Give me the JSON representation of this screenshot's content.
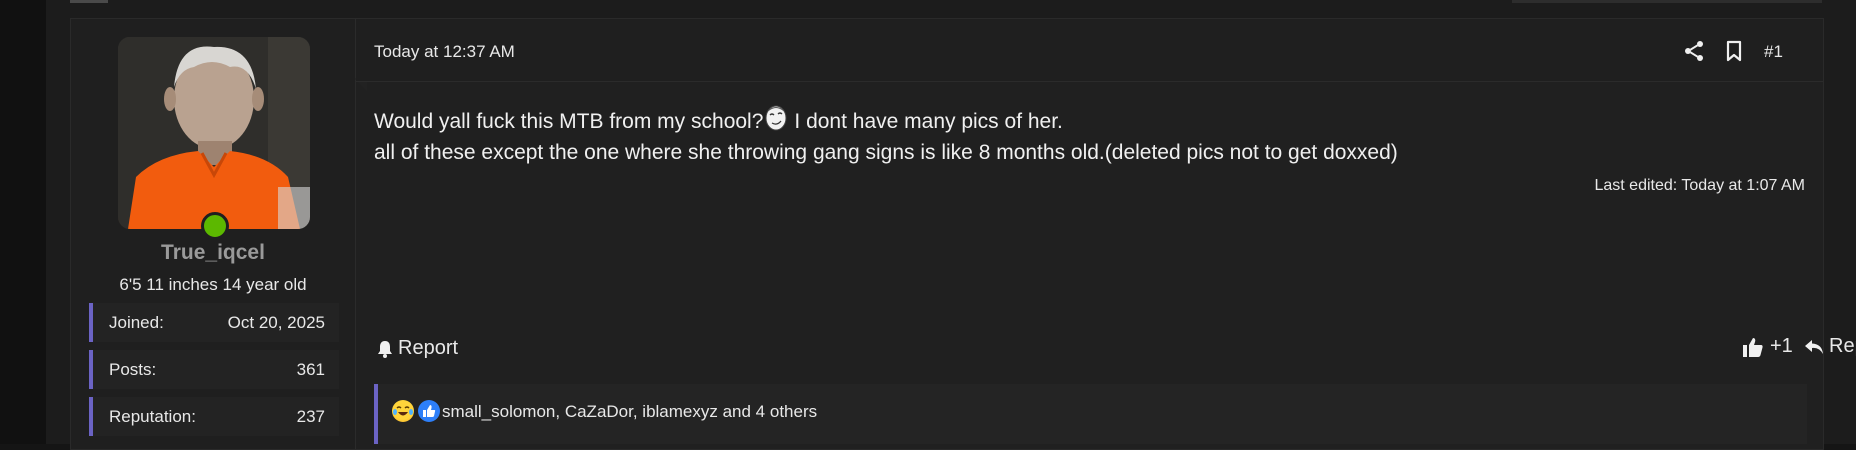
{
  "post": {
    "user": {
      "username": "True_iqcel",
      "title": "6'5 11 inches 14 year old",
      "online": true,
      "stats": [
        {
          "label": "Joined:",
          "value": "Oct 20, 2025"
        },
        {
          "label": "Posts:",
          "value": "361"
        },
        {
          "label": "Reputation:",
          "value": "237"
        }
      ]
    },
    "header": {
      "date": "Today at 12:37 AM",
      "post_number": "#1"
    },
    "body": {
      "line1_before": "Would yall fuck this MTB from my school?",
      "line1_after": "I dont have many pics of her.",
      "line2": "all of these except the one where she throwing gang signs is like 8 months old.(deleted pics not to get doxxed)"
    },
    "last_edited": "Last edited: Today at 1:07 AM",
    "actions": {
      "report": "Report",
      "like": "+1",
      "reply": "Reply"
    },
    "reactions": {
      "summary": "small_solomon, CaZaDor, iblamexyz and 4 others",
      "icons": [
        "laughing-crying-icon",
        "like-icon"
      ]
    }
  },
  "colors": {
    "accent_bar": "#6b63c4",
    "online": "#5cb800",
    "background": "#202020"
  }
}
